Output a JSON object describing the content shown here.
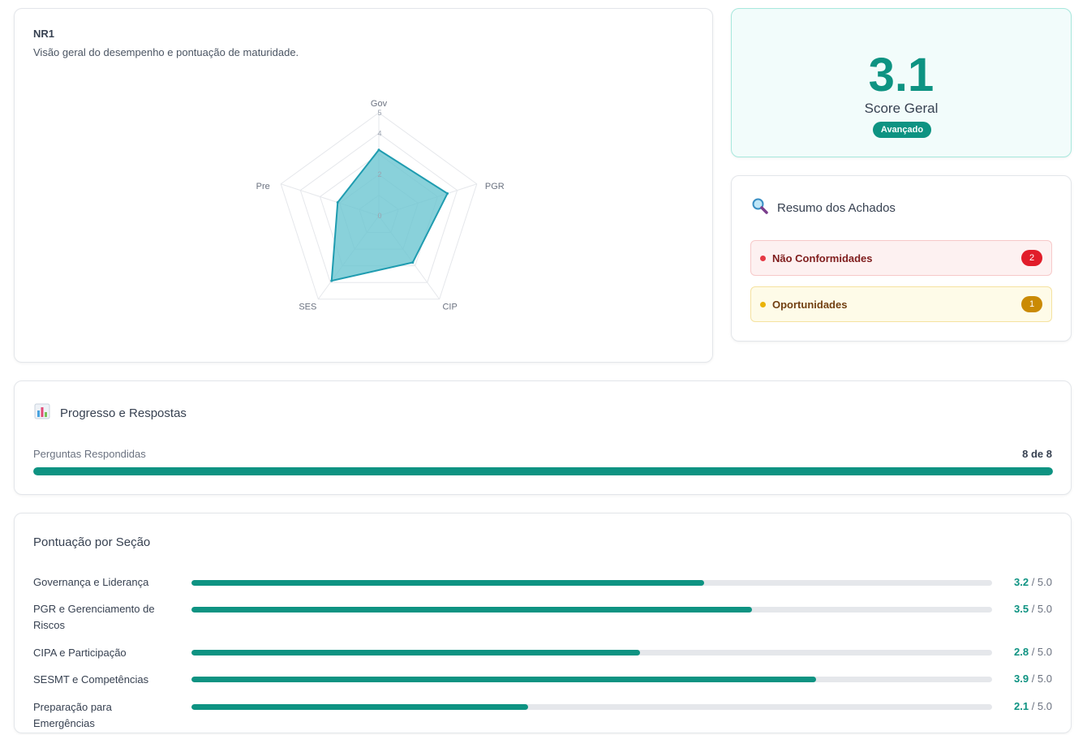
{
  "radar": {
    "title": "NR1",
    "subtitle": "Visão geral do desempenho e pontuação de maturidade.",
    "chart_data": {
      "type": "radar",
      "axes": [
        "Gov",
        "PGR",
        "CIP",
        "SES",
        "Pre"
      ],
      "values": [
        3.2,
        3.5,
        2.8,
        3.9,
        2.1
      ],
      "rlim": [
        0,
        5
      ],
      "ticks": [
        "0",
        "2",
        "4",
        "5"
      ],
      "fill_color": "#6cc5d1",
      "line_color": "#1f9cb0"
    }
  },
  "score": {
    "value": "3.1",
    "label": "Score Geral",
    "badge": "Avançado"
  },
  "findings": {
    "title": "Resumo dos Achados",
    "icon": "magnifier-icon",
    "items": [
      {
        "label": "Não Conformidades",
        "count": "2",
        "color": "#dc2626"
      },
      {
        "label": "Oportunidades",
        "count": "1",
        "color": "#ca8a04"
      }
    ]
  },
  "progress": {
    "title": "Progresso e Respostas",
    "icon": "bar-chart-icon",
    "label": "Perguntas Respondidas",
    "count": "8 de 8",
    "fraction": 1.0
  },
  "sections": {
    "title": "Pontuação por Seção",
    "max_label": "/ 5.0",
    "items": [
      {
        "name": "Governança e Liderança",
        "score": "3.2",
        "value": 3.2
      },
      {
        "name": "PGR e Gerenciamento de Riscos",
        "score": "3.5",
        "value": 3.5
      },
      {
        "name": "CIPA e Participação",
        "score": "2.8",
        "value": 2.8
      },
      {
        "name": "SESMT e Competências",
        "score": "3.9",
        "value": 3.9
      },
      {
        "name": "Preparação para Emergências",
        "score": "2.1",
        "value": 2.1
      }
    ]
  }
}
